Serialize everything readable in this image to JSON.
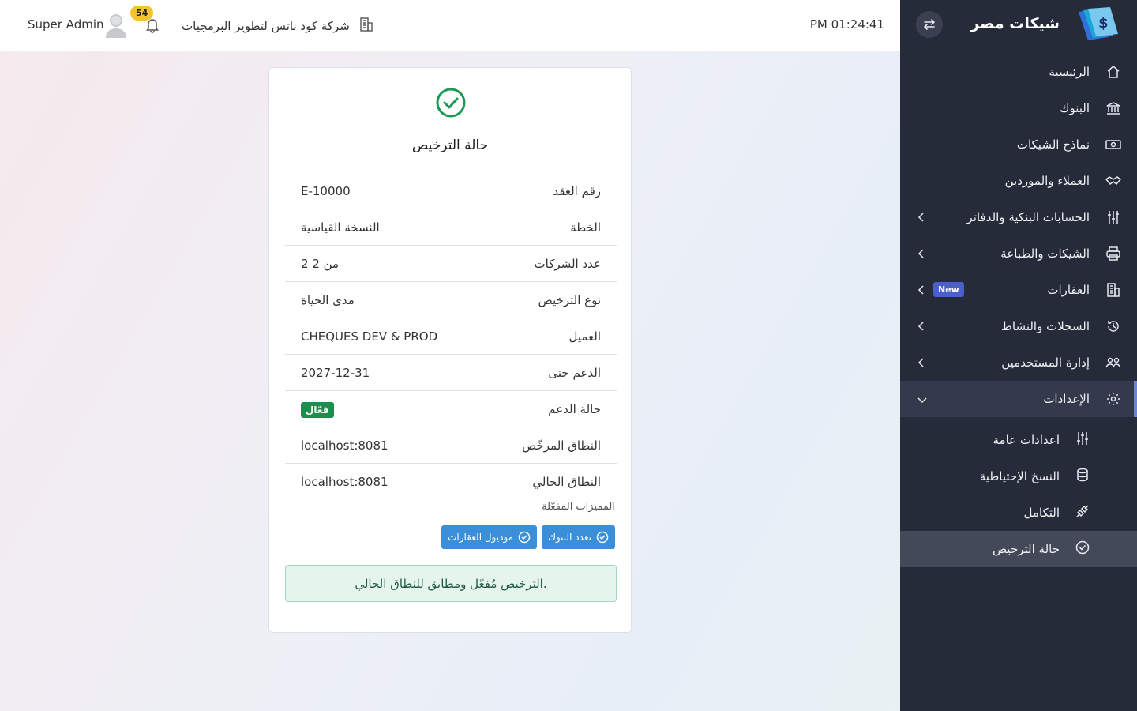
{
  "sidebar": {
    "brand_title": "شيكات مصر",
    "items": [
      {
        "label": "الرئيسية",
        "icon": "home-icon"
      },
      {
        "label": "البنوك",
        "icon": "bank-icon"
      },
      {
        "label": "نماذج الشيكات",
        "icon": "money-icon"
      },
      {
        "label": "العملاء والموردين",
        "icon": "handshake-icon"
      },
      {
        "label": "الحسابات البنكية والدفاتر",
        "icon": "sliders-icon"
      },
      {
        "label": "الشيكات والطباعة",
        "icon": "printer-icon"
      },
      {
        "label": "العقارات",
        "icon": "building-icon",
        "badge": "New"
      },
      {
        "label": "السجلات والنشاط",
        "icon": "history-icon"
      },
      {
        "label": "إدارة المستخدمين",
        "icon": "users-icon"
      },
      {
        "label": "الإعدادات",
        "icon": "gear-icon"
      }
    ],
    "subitems": [
      {
        "label": "اعدادات عامة",
        "icon": "adjustments-icon"
      },
      {
        "label": "النسخ الإحتياطية",
        "icon": "database-icon"
      },
      {
        "label": "التكامل",
        "icon": "plug-icon"
      },
      {
        "label": "حالة الترخيص",
        "icon": "check-circle-icon"
      }
    ]
  },
  "header": {
    "clock": "PM 01:24:41",
    "company": "شركة كود ناتس لتطوير البرمجيات",
    "notification_count": "54",
    "username": "Super Admin"
  },
  "card": {
    "title": "حالة الترخيص",
    "rows": [
      {
        "key": "رقم العقد",
        "value": "E-10000"
      },
      {
        "key": "الخطة",
        "value": "النسخة القياسية"
      },
      {
        "key": "عدد الشركات",
        "value": "2 من 2"
      },
      {
        "key": "نوع الترخيص",
        "value": "مدى الحياة"
      },
      {
        "key": "العميل",
        "value": "CHEQUES DEV & PROD"
      },
      {
        "key": "الدعم حتى",
        "value": "2027-12-31"
      },
      {
        "key": "حالة الدعم",
        "value": "فعّال"
      },
      {
        "key": "النطاق المرخّص",
        "value": "localhost:8081"
      },
      {
        "key": "النطاق الحالي",
        "value": "localhost:8081"
      }
    ],
    "features_label": "المميزات المفعّلة",
    "features": [
      "تعدد البنوك",
      "موديول العقارات"
    ],
    "alert": "الترخيص مُفعّل ومطابق للنطاق الحالي."
  },
  "colors": {
    "sidebar_bg": "#262b3a",
    "accent": "#6b86d6",
    "success": "#1a8f4e",
    "feature_badge": "#3a8fd8",
    "notif_badge": "#f4c430"
  }
}
